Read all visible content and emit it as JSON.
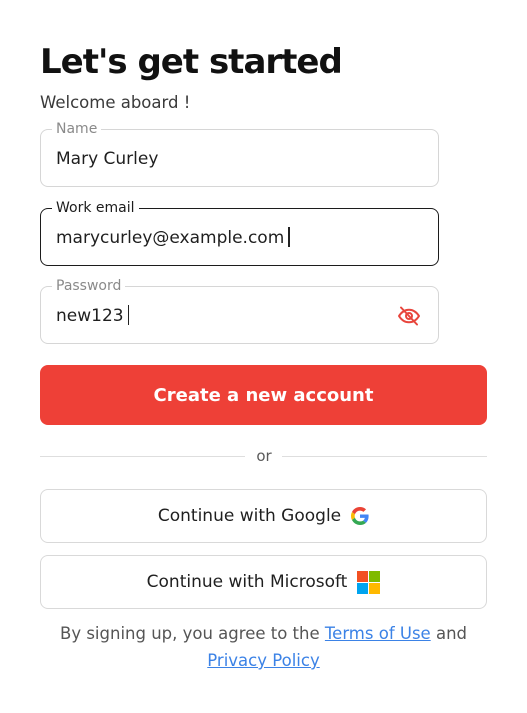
{
  "heading": "Let's get started",
  "subtitle": "Welcome aboard !",
  "fields": {
    "name": {
      "label": "Name",
      "value": "Mary Curley"
    },
    "email": {
      "label": "Work email",
      "value": "marycurley@example.com"
    },
    "password": {
      "label": "Password",
      "value": "new123",
      "toggle_icon": "eye-off-icon"
    }
  },
  "primary_button": {
    "label": "Create a new account",
    "color": "#ee4037"
  },
  "divider_text": "or",
  "oauth": {
    "google": {
      "label": "Continue with Google",
      "icon": "google-logo-icon"
    },
    "microsoft": {
      "label": "Continue with Microsoft",
      "icon": "microsoft-logo-icon"
    }
  },
  "terms": {
    "prefix": "By signing up, you agree to the",
    "terms_link": "Terms of Use",
    "conjunction": "and",
    "privacy_link": "Privacy Policy",
    "link_color": "#3b82e6"
  }
}
